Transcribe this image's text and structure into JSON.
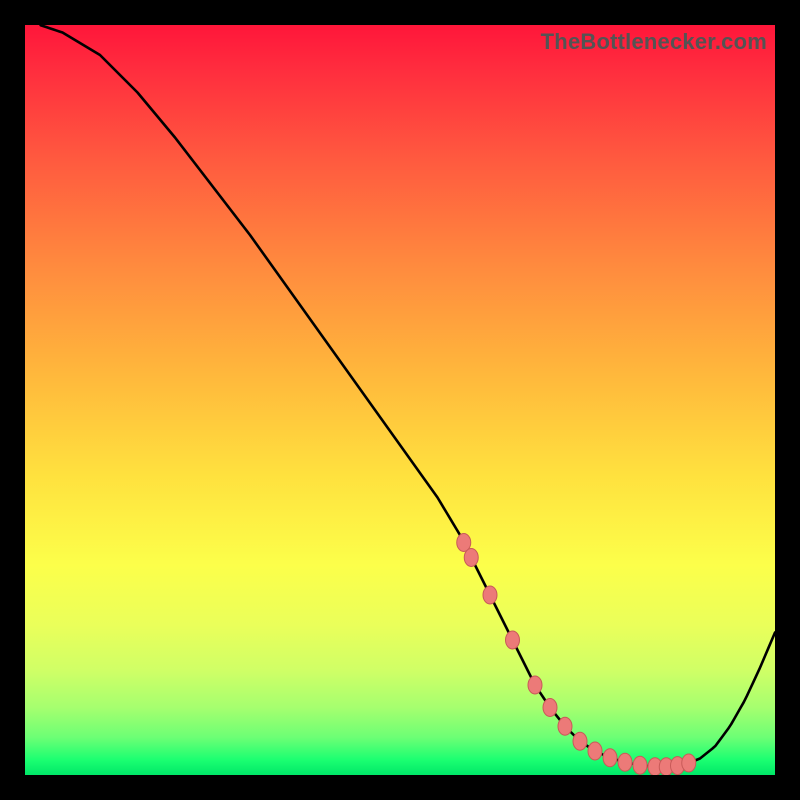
{
  "watermark": "TheBottlenecker.com",
  "chart_data": {
    "type": "line",
    "title": "",
    "xlabel": "",
    "ylabel": "",
    "xlim": [
      0,
      100
    ],
    "ylim": [
      0,
      100
    ],
    "x": [
      2,
      5,
      10,
      15,
      20,
      25,
      30,
      35,
      40,
      45,
      50,
      55,
      58,
      60,
      62,
      65,
      68,
      70,
      72,
      74,
      76,
      78,
      80,
      82,
      84,
      86,
      88,
      90,
      92,
      94,
      96,
      98,
      100
    ],
    "values": [
      100,
      99,
      96,
      91,
      85,
      78.5,
      72,
      65,
      58,
      51,
      44,
      37,
      32,
      28,
      24,
      18,
      12,
      9,
      6.5,
      4.5,
      3.2,
      2.3,
      1.7,
      1.3,
      1.1,
      1.1,
      1.4,
      2.2,
      3.8,
      6.5,
      10,
      14.3,
      19
    ],
    "optimal_band": {
      "x_start": 58,
      "x_end": 89
    },
    "markers_x": [
      58.5,
      59.5,
      62.0,
      65.0,
      68.0,
      70.0,
      72.0,
      74.0,
      76.0,
      78.0,
      80.0,
      82.0,
      84.0,
      85.5,
      87.0,
      88.5
    ]
  },
  "style": {
    "curve_color": "#000000",
    "curve_width": 2.6,
    "marker_fill": "#ec7a78",
    "marker_stroke": "#c85a58",
    "marker_rx": 7.0,
    "marker_ry": 9.0
  }
}
